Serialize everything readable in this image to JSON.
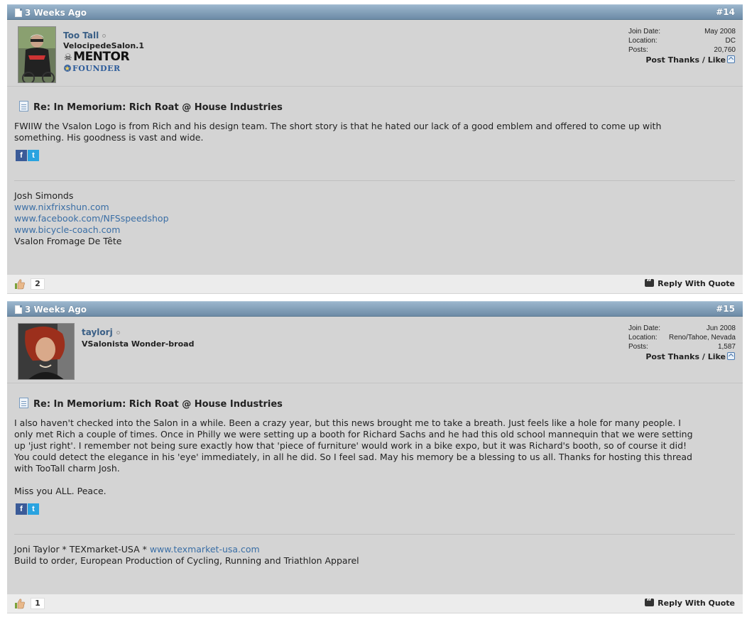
{
  "posts": [
    {
      "date": "3 Weeks Ago",
      "number": "#14",
      "username": "Too Tall",
      "user_title": "VelocipedeSalon.1",
      "rank_mentor": "MENTOR",
      "rank_founder": "FOUNDER",
      "join_date_label": "Join Date:",
      "join_date": "May 2008",
      "location_label": "Location:",
      "location": "DC",
      "posts_label": "Posts:",
      "posts": "20,760",
      "post_thanks": "Post Thanks / Like",
      "title": "Re: In Memorium: Rich Roat @ House Industries",
      "body": [
        "FWIIW the Vsalon Logo is from Rich and his design team. The short story is that he hated our lack of a good emblem and offered to come up with",
        "something. His goodness is vast and wide."
      ],
      "signature": {
        "name": "Josh Simonds",
        "links": [
          "www.nixfrixshun.com",
          "www.facebook.com/NFSspeedshop",
          "www.bicycle-coach.com"
        ],
        "tagline": "Vsalon Fromage De Tête"
      },
      "like_count": "2",
      "reply_with_quote": "Reply With Quote"
    },
    {
      "date": "3 Weeks Ago",
      "number": "#15",
      "username": "taylorj",
      "user_title": "VSalonista Wonder-broad",
      "join_date_label": "Join Date:",
      "join_date": "Jun 2008",
      "location_label": "Location:",
      "location": "Reno/Tahoe, Nevada",
      "posts_label": "Posts:",
      "posts": "1,587",
      "post_thanks": "Post Thanks / Like",
      "title": "Re: In Memorium: Rich Roat @ House Industries",
      "body": [
        "I also haven't checked into the Salon in a while. Been a crazy year, but this news brought me to take a breath. Just feels like a hole for many people. I",
        "only met Rich a couple of times. Once in Philly we were setting up a booth for Richard Sachs and he had this old school mannequin that we were setting",
        "up 'just right'. I remember not being sure exactly how that 'piece of furniture' would work in a bike expo, but it was Richard's booth, so of course it did!",
        "You could detect the elegance in his 'eye' immediately, in all he did. So I feel sad. May his memory be a blessing to us all. Thanks for hosting this thread",
        "with TooTall charm Josh.",
        "Miss you ALL. Peace."
      ],
      "signature": {
        "line1_prefix": "Joni Taylor * TEXmarket-USA * ",
        "line1_link": "www.texmarket-usa.com",
        "line2": "Build to order, European Production of Cycling, Running and Triathlon Apparel"
      },
      "like_count": "1",
      "reply_with_quote": "Reply With Quote"
    }
  ],
  "colors": {
    "header_bar": "#7e9cb7",
    "post_bg": "#d4d4d4",
    "link": "#3a6ea5",
    "username": "#3a5f86"
  }
}
